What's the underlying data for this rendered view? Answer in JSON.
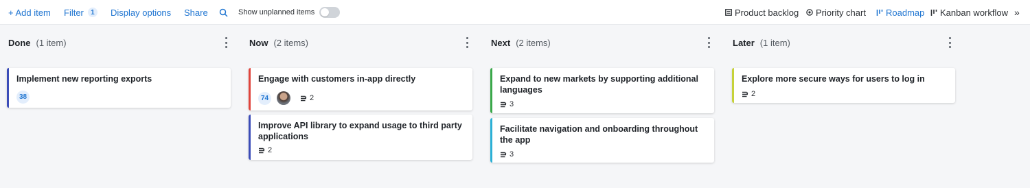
{
  "toolbar": {
    "add_item": "+ Add item",
    "filter": "Filter",
    "filter_count": "1",
    "display_options": "Display options",
    "share": "Share",
    "show_unplanned": "Show unplanned items",
    "views": {
      "product_backlog": "Product backlog",
      "priority_chart": "Priority chart",
      "roadmap": "Roadmap",
      "kanban_workflow": "Kanban workflow"
    },
    "more": "»"
  },
  "columns": [
    {
      "title": "Done",
      "count": "(1 item)",
      "cards": [
        {
          "title": "Implement new reporting exports",
          "score": "38",
          "accent": "#3b4cb8"
        }
      ]
    },
    {
      "title": "Now",
      "count": "(2 items)",
      "cards": [
        {
          "title": "Engage with customers in-app directly",
          "score": "74",
          "subitems": "2",
          "accent": "#e0443c"
        },
        {
          "title": "Improve API library to expand usage to third party applications",
          "subitems": "2",
          "accent": "#3b4cb8"
        }
      ]
    },
    {
      "title": "Next",
      "count": "(2 items)",
      "cards": [
        {
          "title": "Expand to new markets by supporting additional languages",
          "subitems": "3",
          "accent": "#3aa84a"
        },
        {
          "title": "Facilitate navigation and onboarding throughout the app",
          "subitems": "3",
          "accent": "#2bb0d6"
        }
      ]
    },
    {
      "title": "Later",
      "count": "(1 item)",
      "cards": [
        {
          "title": "Explore more secure ways for users to log in",
          "subitems": "2",
          "accent": "#c6d23a"
        }
      ]
    }
  ]
}
